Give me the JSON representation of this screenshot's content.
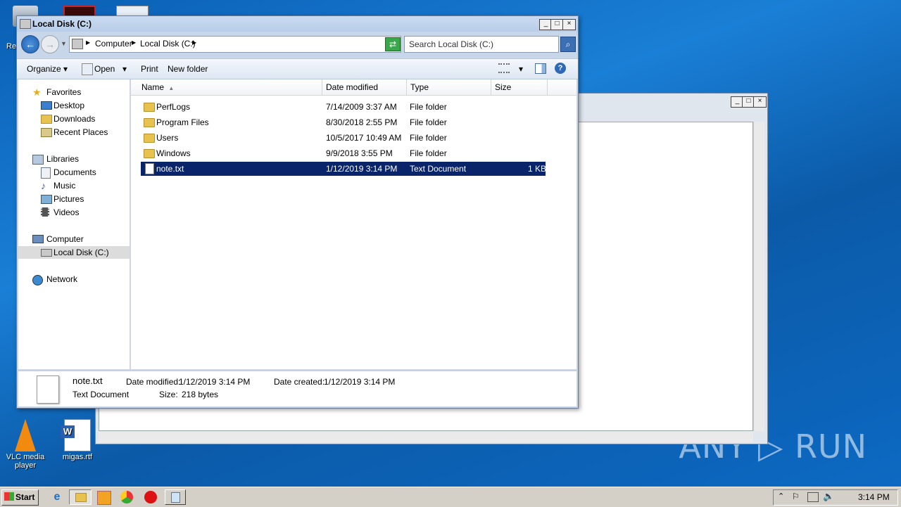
{
  "desktop": {
    "icons": [
      {
        "label": "VLC media player"
      },
      {
        "label": "migas.rtf"
      }
    ],
    "partial_label": "Re",
    "watermark": "ANY ▷ RUN"
  },
  "explorer": {
    "title": "Local Disk (C:)",
    "breadcrumb": [
      "Computer",
      "Local Disk (C:)"
    ],
    "search_placeholder": "Search Local Disk (C:)",
    "toolbar": {
      "organize": "Organize",
      "open": "Open",
      "print": "Print",
      "new_folder": "New folder"
    },
    "nav": {
      "favorites": "Favorites",
      "desktop": "Desktop",
      "downloads": "Downloads",
      "recent_places": "Recent Places",
      "libraries": "Libraries",
      "documents": "Documents",
      "music": "Music",
      "pictures": "Pictures",
      "videos": "Videos",
      "computer": "Computer",
      "local_disk": "Local Disk (C:)",
      "network": "Network"
    },
    "columns": {
      "name": "Name",
      "date": "Date modified",
      "type": "Type",
      "size": "Size"
    },
    "files": [
      {
        "name": "PerfLogs",
        "date": "7/14/2009 3:37 AM",
        "type": "File folder",
        "size": ""
      },
      {
        "name": "Program Files",
        "date": "8/30/2018 2:55 PM",
        "type": "File folder",
        "size": ""
      },
      {
        "name": "Users",
        "date": "10/5/2017 10:49 AM",
        "type": "File folder",
        "size": ""
      },
      {
        "name": "Windows",
        "date": "9/9/2018 3:55 PM",
        "type": "File folder",
        "size": ""
      },
      {
        "name": "note.txt",
        "date": "1/12/2019 3:14 PM",
        "type": "Text Document",
        "size": "1 KB"
      }
    ],
    "details": {
      "name": "note.txt",
      "kind": "Text Document",
      "modified_label": "Date modified:",
      "modified_value": "1/12/2019 3:14 PM",
      "created_label": "Date created:",
      "created_value": "1/12/2019 3:14 PM",
      "size_label": "Size:",
      "size_value": "218 bytes"
    }
  },
  "taskbar": {
    "start": "Start",
    "clock": "3:14 PM"
  }
}
